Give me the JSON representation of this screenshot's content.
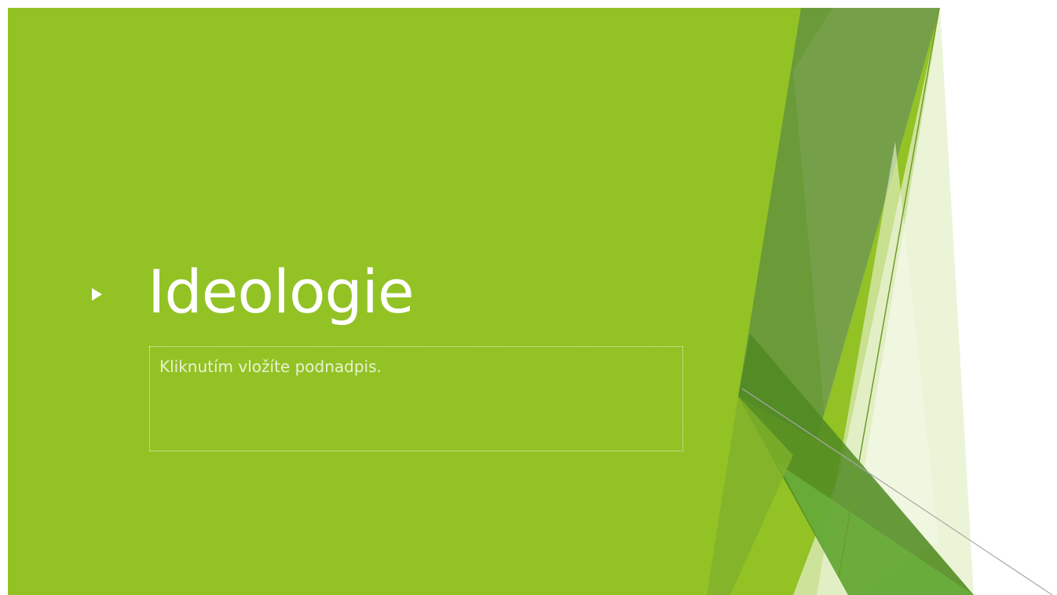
{
  "slide": {
    "title": "Ideologie",
    "subtitle_placeholder": "Kliknutím vložíte podnadpis."
  },
  "theme": {
    "background_color": "#93c225",
    "accent_dark": "#5d8f3a",
    "accent_light": "#d5e8ad",
    "text_color": "#ffffff"
  }
}
